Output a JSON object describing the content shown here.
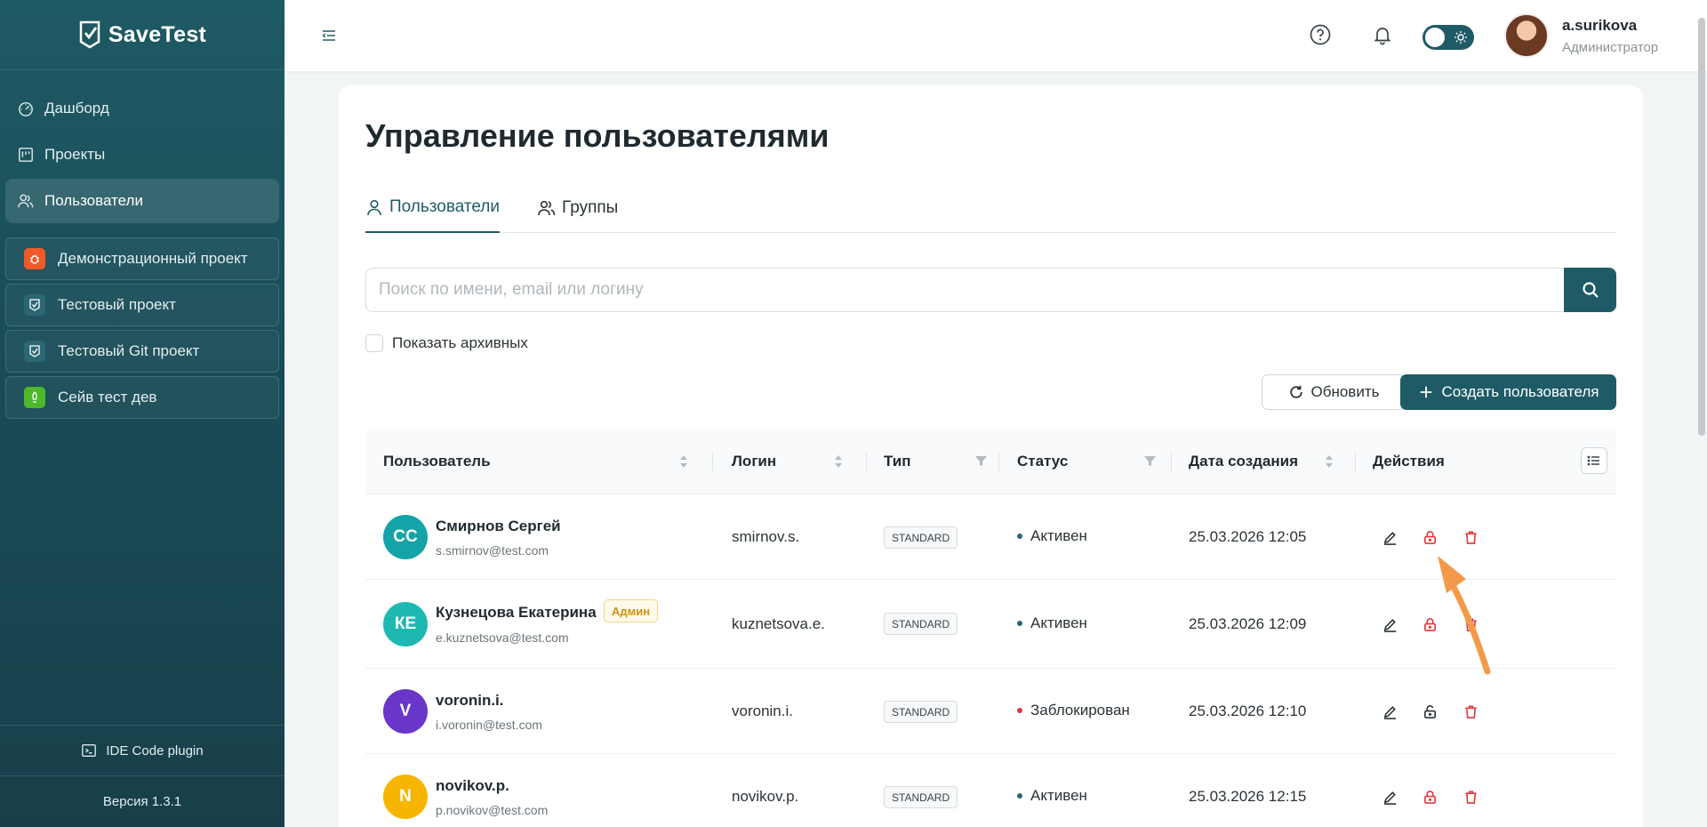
{
  "app": {
    "name": "SaveTest"
  },
  "sidebar": {
    "nav": [
      {
        "label": "Дашборд",
        "icon": "dashboard-icon"
      },
      {
        "label": "Проекты",
        "icon": "projects-icon"
      },
      {
        "label": "Пользователи",
        "icon": "users-icon",
        "active": true
      }
    ],
    "projects": [
      {
        "label": "Демонстрационный проект",
        "color": "#f05a28",
        "icon": "bug-icon"
      },
      {
        "label": "Тестовый проект",
        "color": "#2b6773",
        "icon": "savetest-icon"
      },
      {
        "label": "Тестовый Git проект",
        "color": "#2b6773",
        "icon": "savetest-icon"
      },
      {
        "label": "Сейв тест дев",
        "color": "#4cb82a",
        "icon": "rocket-icon"
      }
    ],
    "ide_plugin": "IDE Code plugin",
    "version": "Версия 1.3.1"
  },
  "header": {
    "user": {
      "name": "a.surikova",
      "role": "Администратор"
    }
  },
  "main": {
    "title": "Управление пользователями",
    "tabs": [
      {
        "label": "Пользователи",
        "active": true
      },
      {
        "label": "Группы"
      }
    ],
    "search": {
      "placeholder": "Поиск по имени, email или логину",
      "value": ""
    },
    "show_archived": {
      "label": "Показать архивных",
      "checked": false
    },
    "refresh_label": "Обновить",
    "create_label": "Создать пользователя",
    "table": {
      "columns": [
        "Пользователь",
        "Логин",
        "Тип",
        "Статус",
        "Дата создания",
        "Действия"
      ],
      "rows": [
        {
          "initials": "СС",
          "avatar_color": "#14a3a8",
          "name": "Смирнов Сергей",
          "email": "s.smirnov@test.com",
          "admin": "",
          "login": "smirnov.s.",
          "type": "STANDARD",
          "status": "Активен",
          "status_color": "#2b6773",
          "created": "25.03.2026 12:05",
          "locked": false
        },
        {
          "initials": "КЕ",
          "avatar_color": "#1db8b2",
          "name": "Кузнецова Екатерина",
          "email": "e.kuznetsova@test.com",
          "admin": "Админ",
          "login": "kuznetsova.e.",
          "type": "STANDARD",
          "status": "Активен",
          "status_color": "#2b6773",
          "created": "25.03.2026 12:09",
          "locked": false
        },
        {
          "initials": "V",
          "avatar_color": "#6a35c9",
          "name": "voronin.i.",
          "email": "i.voronin@test.com",
          "admin": "",
          "login": "voronin.i.",
          "type": "STANDARD",
          "status": "Заблокирован",
          "status_color": "#e0373b",
          "created": "25.03.2026 12:10",
          "locked": true
        },
        {
          "initials": "N",
          "avatar_color": "#f7b500",
          "name": "novikov.p.",
          "email": "p.novikov@test.com",
          "admin": "",
          "login": "novikov.p.",
          "type": "STANDARD",
          "status": "Активен",
          "status_color": "#2b6773",
          "created": "25.03.2026 12:15",
          "locked": false
        }
      ]
    }
  },
  "colors": {
    "accent": "#1f5b66",
    "danger": "#e0373b",
    "annotation_arrow": "#f39a4a"
  }
}
